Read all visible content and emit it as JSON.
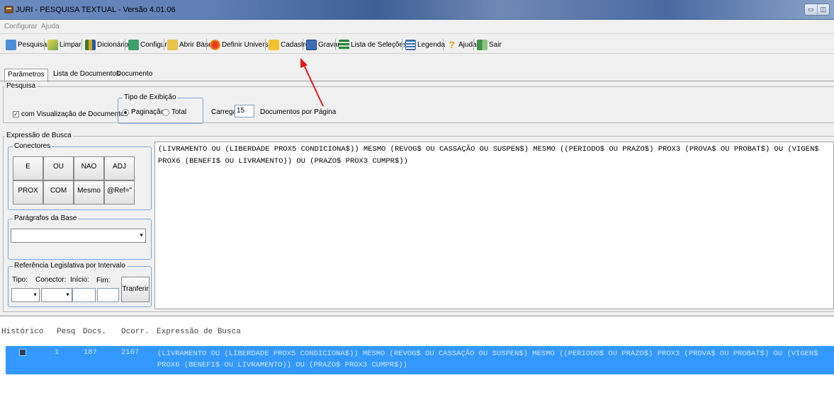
{
  "window": {
    "title": "JURI - PESQUISA TEXTUAL - Versão 4.01.06"
  },
  "menu": [
    "Configurar",
    "Ajuda"
  ],
  "toolbar": [
    {
      "label": "Pesquisar",
      "icon": "search-icon"
    },
    {
      "label": "Limpar",
      "icon": "broom-icon"
    },
    {
      "label": "Dicionário",
      "icon": "books-icon"
    },
    {
      "label": "Configurar",
      "icon": "network-icon"
    },
    {
      "label": "Abrir Base",
      "icon": "folder-open-icon"
    },
    {
      "label": "Definir Universo",
      "icon": "globe-icon"
    },
    {
      "label": "Cadastro",
      "icon": "folder-icon"
    },
    {
      "label": "Gravar",
      "icon": "floppy-icon"
    },
    {
      "label": "Lista de Seleções",
      "icon": "list-icon"
    },
    {
      "label": "Legenda",
      "icon": "legend-icon"
    },
    {
      "label": "Ajuda",
      "icon": "help-icon"
    },
    {
      "label": "Sair",
      "icon": "exit-icon"
    }
  ],
  "tabs": [
    {
      "label": "Parâmetros",
      "active": true
    },
    {
      "label": "Lista de Documentos",
      "active": false
    },
    {
      "label": "Documento",
      "active": false
    }
  ],
  "pesquisa": {
    "group_label": "Pesquisa",
    "checkbox_label": "com Visualização de Documentos",
    "checkbox_checked": true,
    "tipo_label": "Tipo de Exibição",
    "radio_paginacao": "Paginação",
    "radio_total": "Total",
    "carregar_label": "Carregar",
    "carregar_value": "15",
    "docs_label": "Documentos por Página"
  },
  "expressao": {
    "group_label": "Expressão de Busca",
    "conectores_label": "Conectores",
    "conectores": [
      "E",
      "OU",
      "NAO",
      "ADJ",
      "PROX",
      "COM",
      "Mesmo",
      "@Ref=\""
    ],
    "paragrafos_label": "Parágrafos da Base",
    "paragrafos_value": "",
    "ref_label": "Referência Legislativa por Intervalo",
    "tipo_label": "Tipo:",
    "conector_label": "Conector:",
    "inicio_label": "Início:",
    "fim_label": "Fim:",
    "transferir_label": "Tranferir",
    "query": "(LIVRAMENTO OU (LIBERDADE PROX5 CONDICIONA$)) MESMO (REVOG$ OU CASSAÇÃO OU SUSPEN$) MESMO ((PERIODO$ OU PRAZO$) PROX3 (PROVA$ OU PROBAT$) OU (VIGEN$\nPROX6 (BENEFI$ OU LIVRAMENTO)) OU (PRAZO$ PROX3 CUMPR$))"
  },
  "history": {
    "headers": [
      "Histórico",
      "Pesq",
      "Docs.",
      "Ocorr.",
      "Expressão de Busca"
    ],
    "rows": [
      {
        "pesq": "1",
        "docs": "187",
        "ocorr": "2167",
        "expr": "(LIVRAMENTO OU (LIBERDADE PROX5 CONDICIONA$)) MESMO (REVOG$ OU CASSAÇÃO OU SUSPEN$) MESMO ((PERIODO$ OU PRAZO$) PROX3 (PROVA$ OU PROBAT$) OU (VIGEN$\nPROX6 (BENEFI$ OU LIVRAMENTO)) OU (PRAZO$ PROX3 CUMPR$))"
      }
    ]
  },
  "colors": {
    "selection": "#3399ff",
    "annotation_arrow": "#e11a1a"
  }
}
